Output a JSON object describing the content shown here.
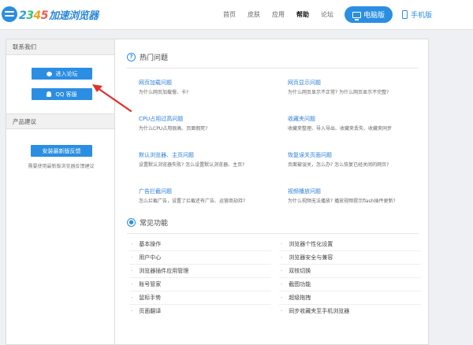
{
  "header": {
    "logo": {
      "numbers": [
        "2",
        "3",
        "4",
        "5"
      ],
      "text": "加速浏览器"
    },
    "nav": [
      {
        "label": "首页",
        "active": false
      },
      {
        "label": "皮肤",
        "active": false
      },
      {
        "label": "应用",
        "active": false
      },
      {
        "label": "帮助",
        "active": true
      },
      {
        "label": "论坛",
        "active": false
      }
    ],
    "pc_button": "电脑版",
    "mobile_button": "手机版"
  },
  "sidebar": {
    "contact_heading": "联系我们",
    "forum_button": "进入论坛",
    "qq_button": "QQ 客服",
    "feedback_heading": "产品建议",
    "feedback_button": "安装最新版反馈",
    "feedback_note": "需要使用最新版浏览器反馈建议"
  },
  "hot_questions": {
    "icon_char": "?",
    "title": "热门问题",
    "items": [
      {
        "title": "网页加载问题",
        "desc": "为什么网页加载慢、卡?"
      },
      {
        "title": "网页显示问题",
        "desc": "为什么网页显示不正常? 为什么网页显示不完整?"
      },
      {
        "title": "CPU占用过高问题",
        "desc": "为什么CPU占用很高、页面假死?"
      },
      {
        "title": "收藏夹问题",
        "desc": "收藏夹整理、导入导出、收藏夹丢失、收藏夹同步"
      },
      {
        "title": "默认浏览器、主页问题",
        "desc": "设置默认浏览器失败? 怎么设置默认浏览器、主页?"
      },
      {
        "title": "恢复误关页面问题",
        "desc": "页面被误关，怎么办? 怎么恢复已经关闭的网页?"
      },
      {
        "title": "广告拦截问题",
        "desc": "怎么拦截广告，设置了拦截还有广告、运营商劫持?"
      },
      {
        "title": "视频播放问题",
        "desc": "为什么视频无法播放? 播放视频提示flash插件更新?"
      }
    ]
  },
  "common_features": {
    "title": "常见功能",
    "left": [
      "基本操作",
      "用户中心",
      "浏览器插件应用管理",
      "账号管家",
      "鼠标手势",
      "页面翻译"
    ],
    "right": [
      "浏览器个性化设置",
      "浏览器安全与兼容",
      "双核切换",
      "截图功能",
      "超级拖拽",
      "同步收藏夹至手机浏览器"
    ]
  },
  "colors": {
    "accent": "#2b8ee2",
    "link": "#2b7fd6",
    "annotation_arrow": "#e0302a"
  }
}
